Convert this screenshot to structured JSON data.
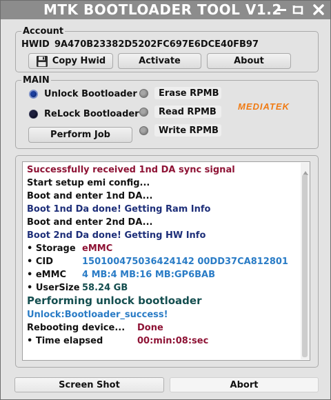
{
  "window": {
    "title": "MTK BOOTLOADER TOOL V1.2"
  },
  "account": {
    "group_label": "Account",
    "hwid_label": "HWID",
    "hwid_value": "9A470B23382D5202FC697E6DCE40FB97",
    "copy_label": "Copy Hwid",
    "activate_label": "Activate",
    "about_label": "About"
  },
  "main": {
    "group_label": "MAIN",
    "unlock_label": "Unlock Bootloader",
    "relock_label": "ReLock Bootloader",
    "perform_label": "Perform Job",
    "erase_label": "Erase RPMB",
    "read_label": "Read RPMB",
    "write_label": "Write RPMB",
    "brand": "MEDIATEK"
  },
  "log": {
    "lines": [
      "Successfully received 1nd DA sync signal",
      "Start setup emi config...",
      "Boot and enter 1nd DA...",
      "Boot 1nd Da done! Getting Ram Info",
      "Boot and enter 2nd DA...",
      "Boot 2nd Da done! Getting HW Info",
      "Performing unlock bootloader",
      "Unlock:Bootloader_success!"
    ],
    "storage_label": "• Storage",
    "storage_value": "eMMC",
    "cid_label": "• CID",
    "cid_value": "150100475036424142 00DD37CA812801",
    "emmc_label": "• eMMC",
    "emmc_value": "4 MB:4 MB:16 MB:GP6BAB",
    "usersize_label": "• UserSize",
    "usersize_value": "58.24 GB",
    "rebooting_label": "Rebooting device...",
    "rebooting_value": "Done",
    "elapsed_label": "• Time elapsed",
    "elapsed_value": "00:min:08:sec"
  },
  "bottom": {
    "screenshot_label": "Screen Shot",
    "abort_label": "Abort"
  },
  "colors": {
    "titlebar": "#8c8c8c",
    "brand": "#f07a12",
    "log_red": "#8e1335",
    "log_navy": "#1e2f79",
    "log_blue": "#2a7cc6",
    "log_teal": "#144e4f"
  }
}
